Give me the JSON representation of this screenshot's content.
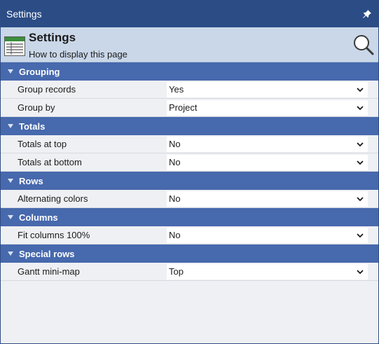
{
  "window": {
    "title": "Settings"
  },
  "header": {
    "title": "Settings",
    "subtitle": "How to display this page"
  },
  "groups": [
    {
      "label": "Grouping",
      "rows": [
        {
          "label": "Group records",
          "value": "Yes"
        },
        {
          "label": "Group by",
          "value": "Project"
        }
      ]
    },
    {
      "label": "Totals",
      "rows": [
        {
          "label": "Totals at top",
          "value": "No"
        },
        {
          "label": "Totals at bottom",
          "value": "No"
        }
      ]
    },
    {
      "label": "Rows",
      "rows": [
        {
          "label": "Alternating colors",
          "value": "No"
        }
      ]
    },
    {
      "label": "Columns",
      "rows": [
        {
          "label": "Fit columns 100%",
          "value": "No"
        }
      ]
    },
    {
      "label": "Special rows",
      "rows": [
        {
          "label": "Gantt mini-map",
          "value": "Top"
        }
      ]
    }
  ],
  "icons": {
    "pin": "pin-icon",
    "grid": "table-grid-icon",
    "search": "search-icon",
    "collapse": "triangle-down-icon",
    "dropdown": "chevron-down-icon"
  },
  "colors": {
    "titlebar": "#2b4c85",
    "header_band": "#c9d7e8",
    "group_header": "#4769ad",
    "row_background": "#eef0f3",
    "grid_icon_green": "#3a8f3a"
  }
}
